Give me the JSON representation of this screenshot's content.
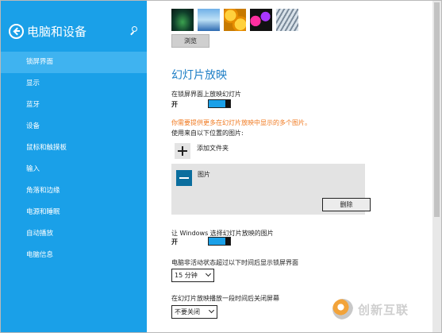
{
  "sidebar": {
    "title": "电脑和设备",
    "items": [
      {
        "label": "锁屏界面",
        "active": true
      },
      {
        "label": "显示"
      },
      {
        "label": "蓝牙"
      },
      {
        "label": "设备"
      },
      {
        "label": "鼠标和触摸板"
      },
      {
        "label": "输入"
      },
      {
        "label": "角落和边缘"
      },
      {
        "label": "电源和睡眠"
      },
      {
        "label": "自动播放"
      },
      {
        "label": "电脑信息"
      }
    ]
  },
  "main": {
    "browse_label": "浏览",
    "slideshow_title": "幻灯片放映",
    "slideshow_toggle": {
      "label": "在锁屏界面上放映幻灯片",
      "state": "开"
    },
    "warning": "你需要提供更多在幻灯片放映中显示的多个图片。",
    "source_label": "使用来自以下位置的图片:",
    "add_folder_label": "添加文件夹",
    "folder_name": "图片",
    "remove_label": "删除",
    "windows_toggle": {
      "label": "让 Windows 选择幻灯片放映的图片",
      "state": "开"
    },
    "inactive_label": "电脑非活动状态超过以下时间后显示锁屏界面",
    "inactive_value": "15 分钟",
    "screen_off_label": "在幻灯片放映播放一段时间后关闭屏幕",
    "screen_off_value": "不要关闭"
  },
  "watermark": "创新互联"
}
